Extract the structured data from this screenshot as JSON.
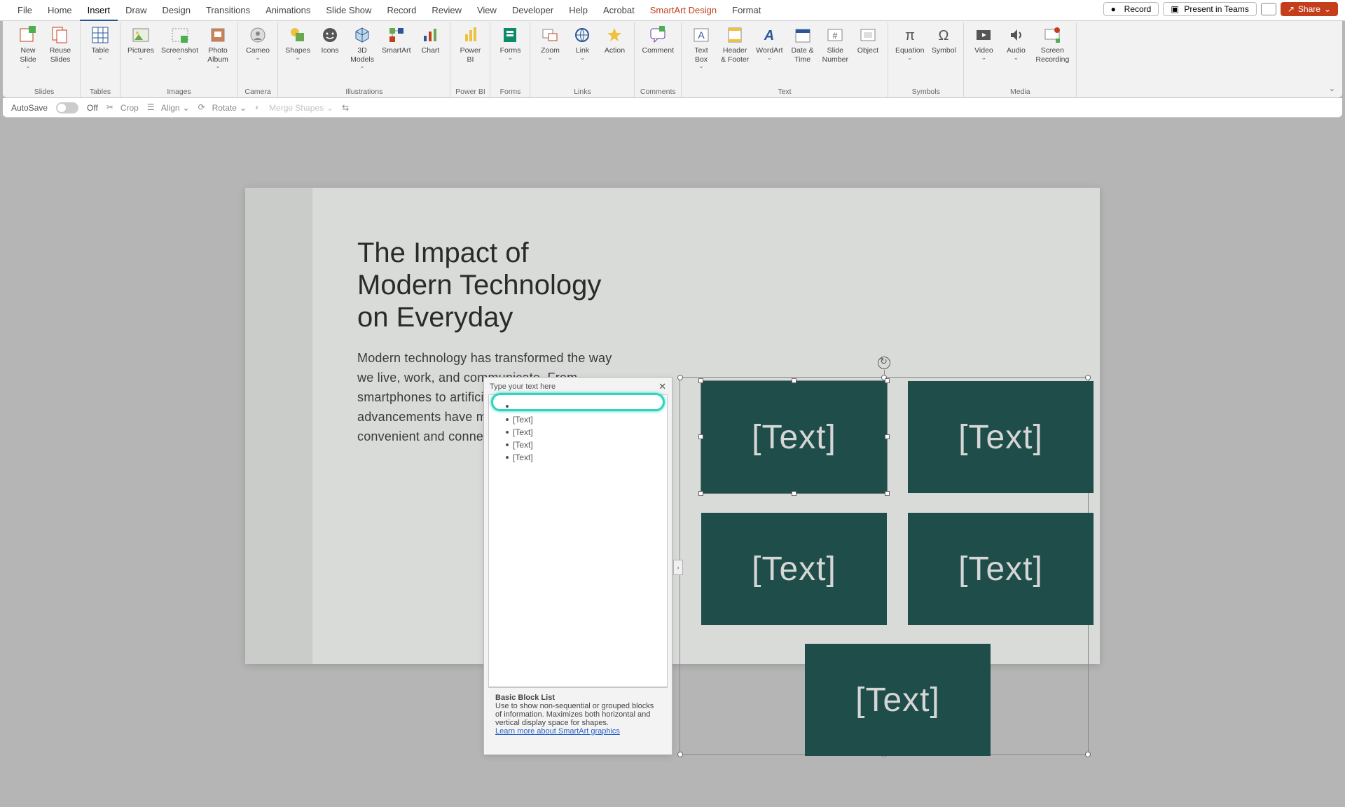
{
  "menubar": {
    "tabs": [
      "File",
      "Home",
      "Insert",
      "Draw",
      "Design",
      "Transitions",
      "Animations",
      "Slide Show",
      "Record",
      "Review",
      "View",
      "Developer",
      "Help",
      "Acrobat",
      "SmartArt Design",
      "Format"
    ],
    "active_index": 2,
    "record": "Record",
    "present": "Present in Teams",
    "share": "Share"
  },
  "ribbon": {
    "slides": {
      "new": "New\nSlide",
      "reuse": "Reuse\nSlides",
      "group": "Slides"
    },
    "tables": {
      "table": "Table",
      "group": "Tables"
    },
    "images": {
      "pictures": "Pictures",
      "screenshot": "Screenshot",
      "album": "Photo\nAlbum",
      "group": "Images"
    },
    "camera": {
      "cameo": "Cameo",
      "group": "Camera"
    },
    "illus": {
      "shapes": "Shapes",
      "icons": "Icons",
      "models": "3D\nModels",
      "smartart": "SmartArt",
      "chart": "Chart",
      "group": "Illustrations"
    },
    "pbi": {
      "pbi": "Power\nBI",
      "group": "Power BI"
    },
    "forms": {
      "forms": "Forms",
      "group": "Forms"
    },
    "links": {
      "zoom": "Zoom",
      "link": "Link",
      "action": "Action",
      "group": "Links"
    },
    "comments": {
      "comment": "Comment",
      "group": "Comments"
    },
    "text": {
      "textbox": "Text\nBox",
      "hf": "Header\n& Footer",
      "wordart": "WordArt",
      "dt": "Date &\nTime",
      "sn": "Slide\nNumber",
      "obj": "Object",
      "group": "Text"
    },
    "symbols": {
      "eq": "Equation",
      "sym": "Symbol",
      "group": "Symbols"
    },
    "media": {
      "video": "Video",
      "audio": "Audio",
      "rec": "Screen\nRecording",
      "group": "Media"
    }
  },
  "qat": {
    "autosave": "AutoSave",
    "off": "Off",
    "crop": "Crop",
    "align": "Align",
    "rotate": "Rotate",
    "merge": "Merge Shapes"
  },
  "slide": {
    "title_l1": "The Impact of",
    "title_l2": "Modern Technology",
    "title_l3": "on Everyday",
    "body": "Modern technology has transformed the way we live, work, and communicate. From smartphones to artificial intelligence, these advancements have made our lives more convenient and connected than ever before."
  },
  "smartart": {
    "placeholder": "[Text]"
  },
  "textpane": {
    "header": "Type your text here",
    "item": "[Text]",
    "info_title": "Basic Block List",
    "info_body": "Use to show non-sequential or grouped blocks of information. Maximizes both horizontal and vertical display space for shapes.",
    "link": "Learn more about SmartArt graphics",
    "toggle": "›"
  }
}
